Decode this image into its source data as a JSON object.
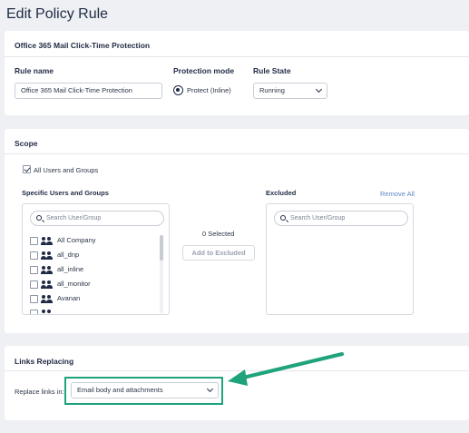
{
  "page": {
    "title": "Edit Policy Rule"
  },
  "rule_card": {
    "header": "Office 365 Mail Click-Time Protection",
    "rule_name_label": "Rule name",
    "rule_name_value": "Office 365 Mail Click-Time Protection",
    "protection_mode_label": "Protection mode",
    "protection_mode_option": "Protect (Inline)",
    "rule_state_label": "Rule State",
    "rule_state_value": "Running"
  },
  "scope_card": {
    "header": "Scope",
    "all_users_label": "All Users and Groups",
    "specific_label": "Specific Users and Groups",
    "excluded_label": "Excluded",
    "remove_all_label": "Remove All",
    "search_placeholder": "Search User/Group",
    "excluded_search_placeholder": "Search User/Group",
    "selected_count": "0 Selected",
    "add_to_excluded_label": "Add to Excluded",
    "groups": [
      "All Company",
      "all_dnp",
      "all_inline",
      "all_monitor",
      "Avanan"
    ]
  },
  "links_card": {
    "header": "Links Replacing",
    "replace_links_label": "Replace links in:",
    "replace_links_value": "Email body and attachments"
  },
  "colors": {
    "accent_green": "#1fa37c",
    "link_blue": "#5f86c4",
    "text_dark": "#1f2a44"
  },
  "icons": [
    "radio-selected-icon",
    "chevron-down-icon",
    "checkbox-icon",
    "search-icon",
    "users-icon",
    "arrow-icon"
  ]
}
